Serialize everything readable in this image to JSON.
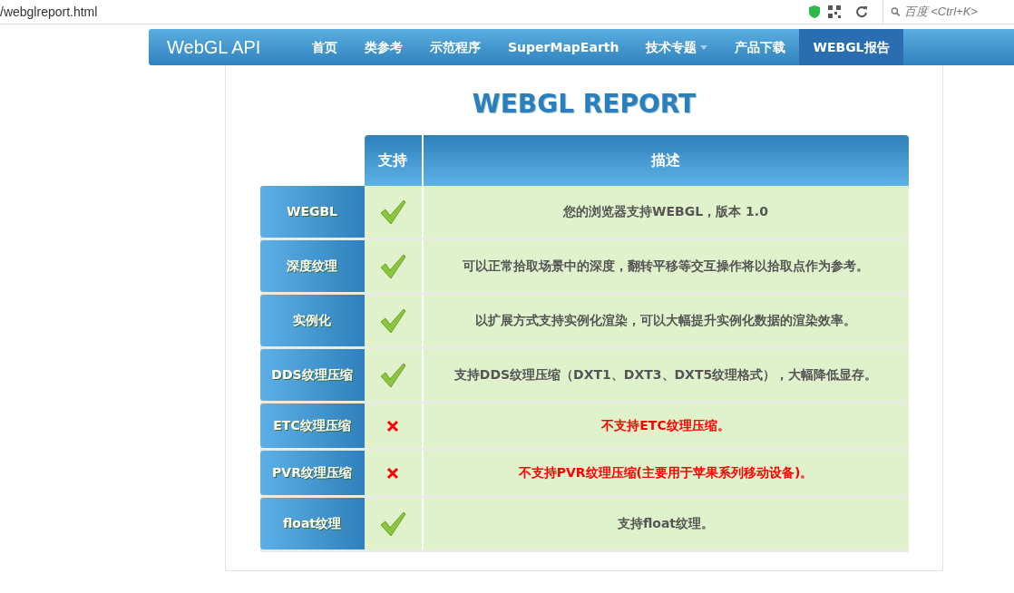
{
  "browser": {
    "url": "/webglreport.html",
    "search": {
      "placeholder": "百度 <Ctrl+K>"
    }
  },
  "navbar": {
    "brand": "WebGL API",
    "items": [
      {
        "label": "首页",
        "selected": false,
        "dropdown": false
      },
      {
        "label": "类参考",
        "selected": false,
        "dropdown": false
      },
      {
        "label": "示范程序",
        "selected": false,
        "dropdown": false
      },
      {
        "label": "SuperMapEarth",
        "selected": false,
        "dropdown": false
      },
      {
        "label": "技术专题",
        "selected": false,
        "dropdown": true
      },
      {
        "label": "产品下载",
        "selected": false,
        "dropdown": false
      },
      {
        "label": "WEBGL报告",
        "selected": true,
        "dropdown": false
      }
    ]
  },
  "report": {
    "title": "WEBGL REPORT",
    "columns": [
      "支持",
      "描述"
    ],
    "rows": [
      {
        "name": "WEGBL",
        "supported": true,
        "description": "您的浏览器支持WEBGL，版本 1.0"
      },
      {
        "name": "深度纹理",
        "supported": true,
        "description": "可以正常拾取场景中的深度，翻转平移等交互操作将以拾取点作为参考。"
      },
      {
        "name": "实例化",
        "supported": true,
        "description": "以扩展方式支持实例化渲染，可以大幅提升实例化数据的渲染效率。"
      },
      {
        "name": "DDS纹理压缩",
        "supported": true,
        "description": "支持DDS纹理压缩（DXT1、DXT3、DXT5纹理格式），大幅降低显存。"
      },
      {
        "name": "ETC纹理压缩",
        "supported": false,
        "description": "不支持ETC纹理压缩。"
      },
      {
        "name": "PVR纹理压缩",
        "supported": false,
        "description": "不支持PVR纹理压缩(主要用于苹果系列移动设备)。"
      },
      {
        "name": "float纹理",
        "supported": true,
        "description": "支持float纹理。"
      }
    ]
  }
}
